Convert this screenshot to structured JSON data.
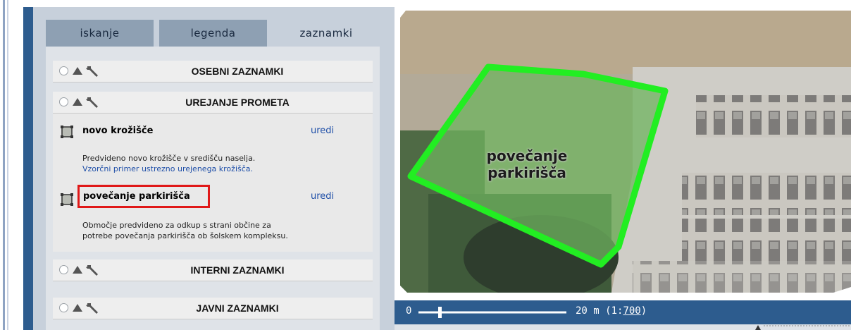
{
  "tabs": [
    {
      "label": "iskanje"
    },
    {
      "label": "legenda"
    },
    {
      "label": "zaznamki"
    }
  ],
  "sections": [
    {
      "title": "OSEBNI ZAZNAMKI"
    },
    {
      "title": "UREJANJE PROMETA"
    },
    {
      "title": "INTERNI ZAZNAMKI"
    },
    {
      "title": "JAVNI ZAZNAMKI"
    }
  ],
  "items": [
    {
      "title": "novo krožišče",
      "edit": "uredi",
      "desc_line1": "Predvideno novo krožišče v središču naselja.",
      "link": "Vzorčni primer ustrezno urejenega krožišča."
    },
    {
      "title": "povečanje parkirišča",
      "edit": "uredi",
      "desc_line1": "Območje predvideno za odkup s strani občine za",
      "desc_line2": "potrebe povečanja parkirišča ob šolskem kompleksu."
    }
  ],
  "map": {
    "polygon_label_line1": "povečanje",
    "polygon_label_line2": "parkirišča",
    "polygon_color": "#22ee22"
  },
  "scale": {
    "zero": "0",
    "distance": "20 m (1:",
    "ratio": "700",
    "close": ")"
  },
  "colors": {
    "panel_blue": "#2d5c8e",
    "link_blue": "#1f4fa8",
    "highlight_red": "#e01818"
  }
}
